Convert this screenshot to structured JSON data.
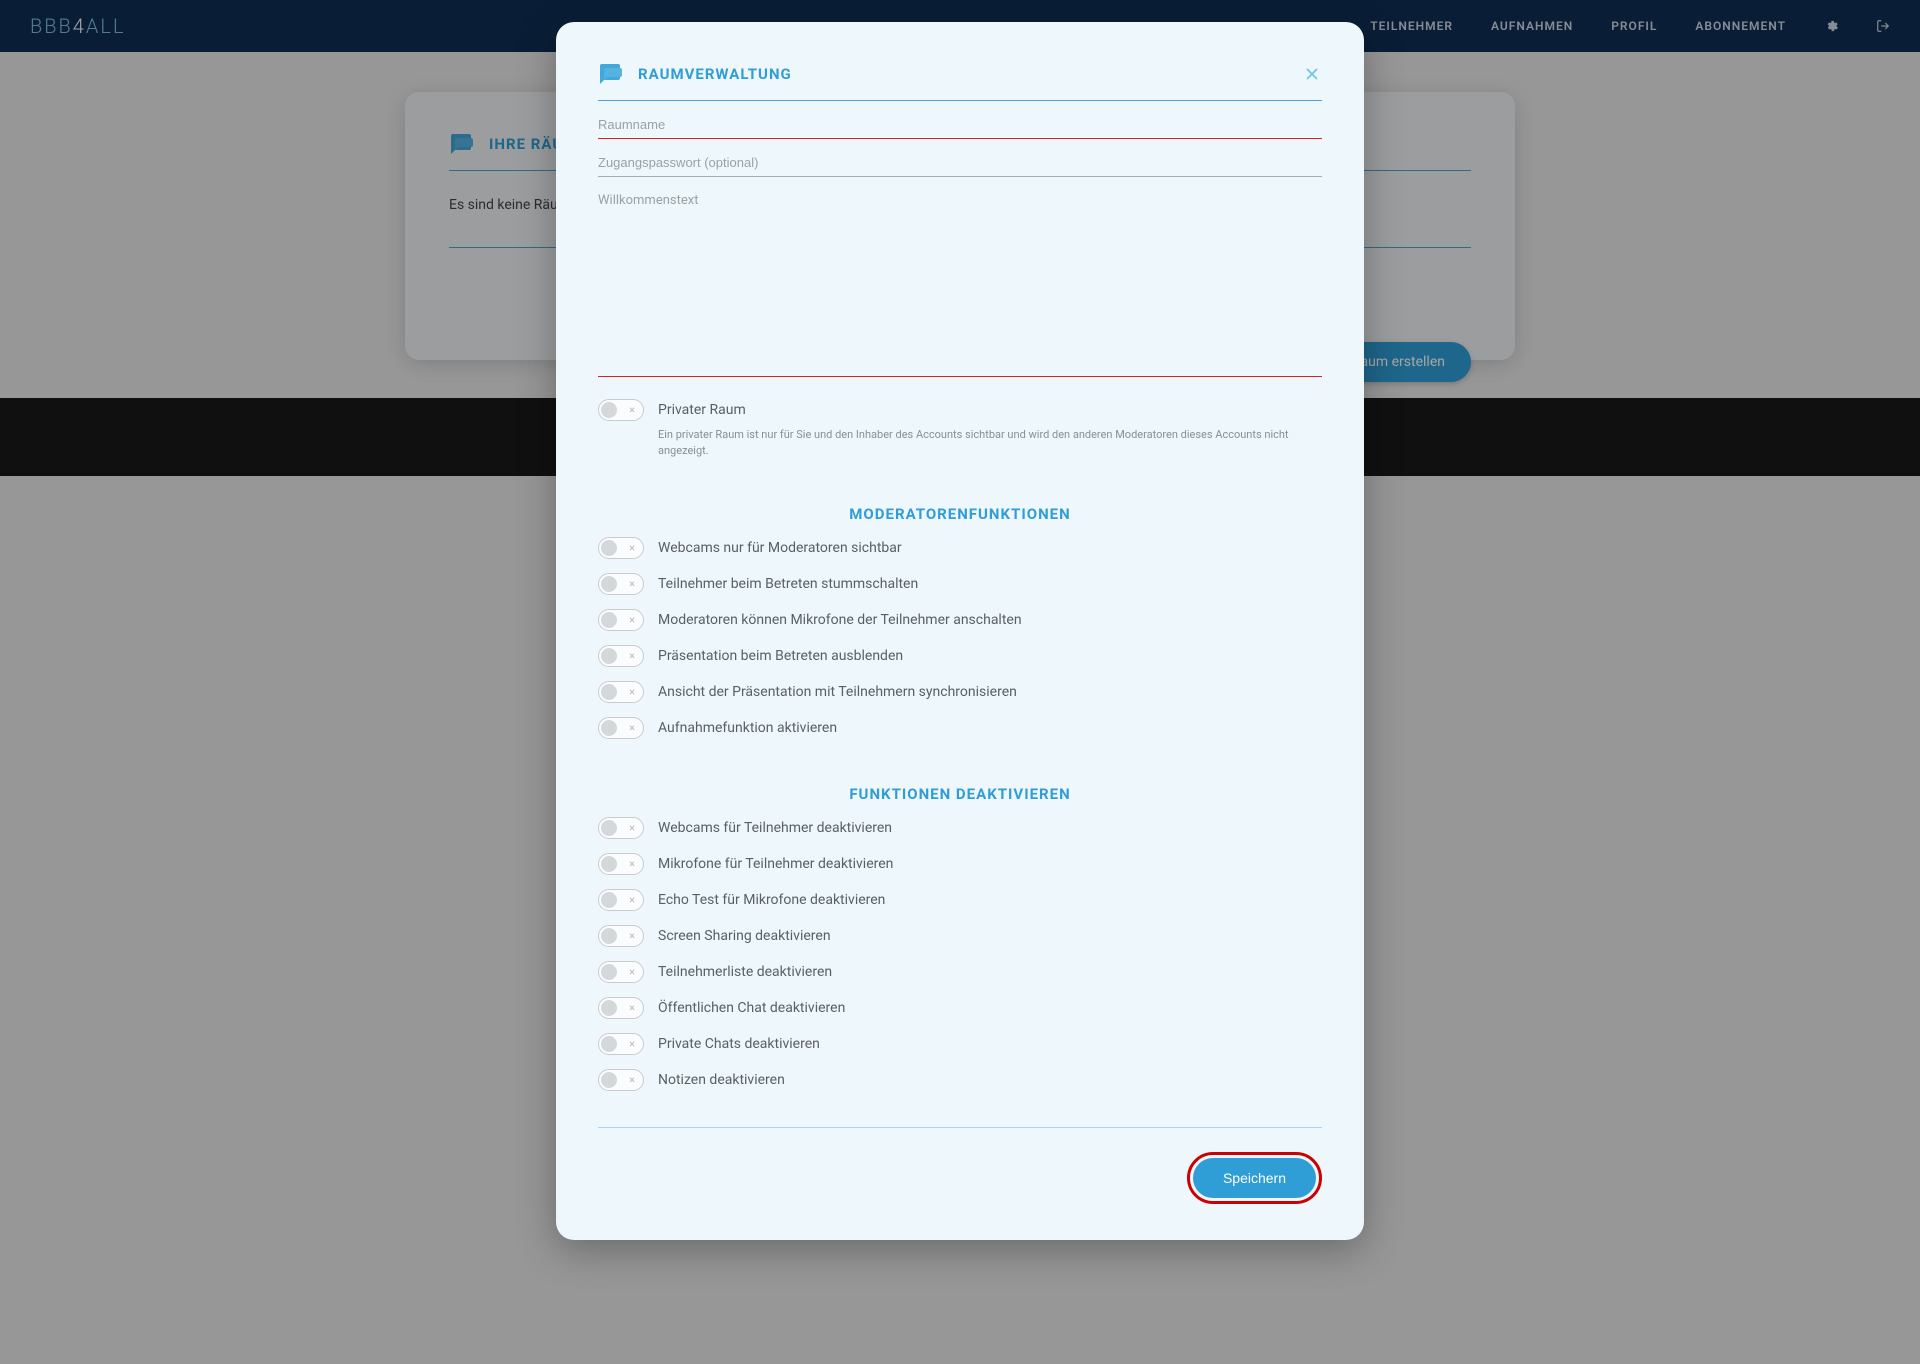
{
  "brand": {
    "part1": "BBB",
    "part2": "4",
    "part3": "ALL"
  },
  "nav": {
    "teilnehmer": "TEILNEHMER",
    "aufnahmen": "AUFNAHMEN",
    "profil": "PROFIL",
    "abonnement": "ABONNEMENT"
  },
  "bgCard": {
    "title": "IHRE RÄUME",
    "body": "Es sind keine Räume vorhanden.",
    "button": "Raum erstellen"
  },
  "modal": {
    "title": "RAUMVERWALTUNG",
    "roomName": {
      "placeholder": "Raumname",
      "value": ""
    },
    "password": {
      "placeholder": "Zugangspasswort (optional)",
      "value": ""
    },
    "welcome": {
      "placeholder": "Willkommenstext",
      "value": ""
    },
    "priv": {
      "label": "Privater Raum",
      "desc": "Ein privater Raum ist nur für Sie und den Inhaber des Accounts sichtbar und wird den anderen Moderatoren dieses Accounts nicht angezeigt."
    },
    "section_mod": "MODERATORENFUNKTIONEN",
    "mod": {
      "webcams": "Webcams nur für Moderatoren sichtbar",
      "mute": "Teilnehmer beim Betreten stummschalten",
      "unmute": "Moderatoren können Mikrofone der Teilnehmer anschalten",
      "hidePres": "Präsentation beim Betreten ausblenden",
      "syncPres": "Ansicht der Präsentation mit Teilnehmern synchronisieren",
      "record": "Aufnahmefunktion aktivieren"
    },
    "section_deact": "FUNKTIONEN DEAKTIVIEREN",
    "deact": {
      "webcams": "Webcams für Teilnehmer deaktivieren",
      "mics": "Mikrofone für Teilnehmer deaktivieren",
      "echo": "Echo Test für Mikrofone deaktivieren",
      "screen": "Screen Sharing deaktivieren",
      "list": "Teilnehmerliste deaktivieren",
      "pubchat": "Öffentlichen Chat deaktivieren",
      "privchat": "Private Chats deaktivieren",
      "notes": "Notizen deaktivieren"
    },
    "save": "Speichern"
  }
}
